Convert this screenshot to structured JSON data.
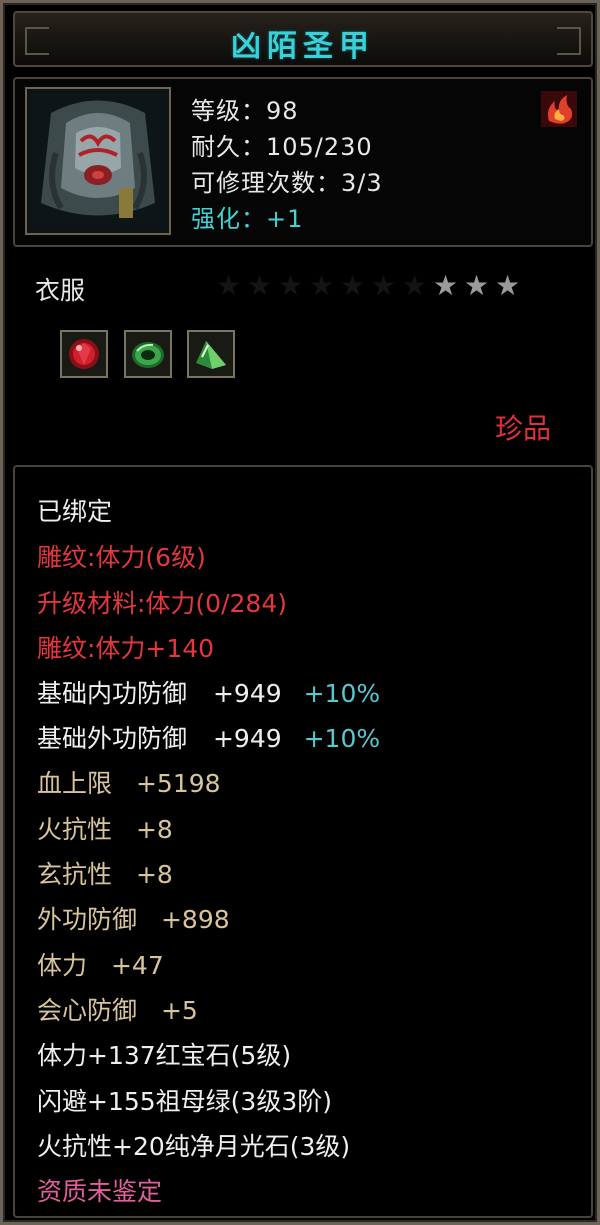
{
  "item": {
    "name": "凶陌圣甲",
    "level_text": "等级：98",
    "durability_text": "耐久：105/230",
    "repair_text": "可修理次数：3/3",
    "enhance_text": "强化：+1",
    "portrait_icon": "armor-portrait-icon",
    "badge_icon": "flame-icon",
    "category": "衣服",
    "stars": {
      "total": 10,
      "lit": 3
    },
    "sockets": [
      {
        "icon": "red-gem-icon",
        "color": "#d0202c"
      },
      {
        "icon": "green-jade-ring-icon",
        "color": "#3aa84a"
      },
      {
        "icon": "green-crystal-icon",
        "color": "#6fcf6a"
      }
    ],
    "rarity": "珍品"
  },
  "attributes": {
    "bound": "已绑定",
    "engrave_level": "雕纹:体力(6级)",
    "upgrade_material": "升级材料:体力(0/284)",
    "engrave_bonus": "雕纹:体力+140",
    "inner_def": {
      "label": "基础内功防御",
      "value": "+949",
      "bonus": "+10%"
    },
    "outer_def": {
      "label": "基础外功防御",
      "value": "+949",
      "bonus": "+10%"
    },
    "hp_max": {
      "label": "血上限",
      "value": "+5198"
    },
    "fire_res": {
      "label": "火抗性",
      "value": "+8"
    },
    "mystic_res": {
      "label": "玄抗性",
      "value": "+8"
    },
    "outer_def2": {
      "label": "外功防御",
      "value": "+898"
    },
    "stamina": {
      "label": "体力",
      "value": "+47"
    },
    "crit_def": {
      "label": "会心防御",
      "value": "+5"
    },
    "gem1": "体力+137红宝石(5级)",
    "gem2": "闪避+155祖母绿(3级3阶)",
    "gem3": "火抗性+20纯净月光石(3级)",
    "quality": "资质未鉴定"
  },
  "colors": {
    "title": "#3ad1d8",
    "white_text": "#efefef",
    "red_text": "#e2383d",
    "tan_text": "#d8c49a",
    "pink_text": "#e25f9a",
    "bonus_cyan": "#58c8d0"
  }
}
